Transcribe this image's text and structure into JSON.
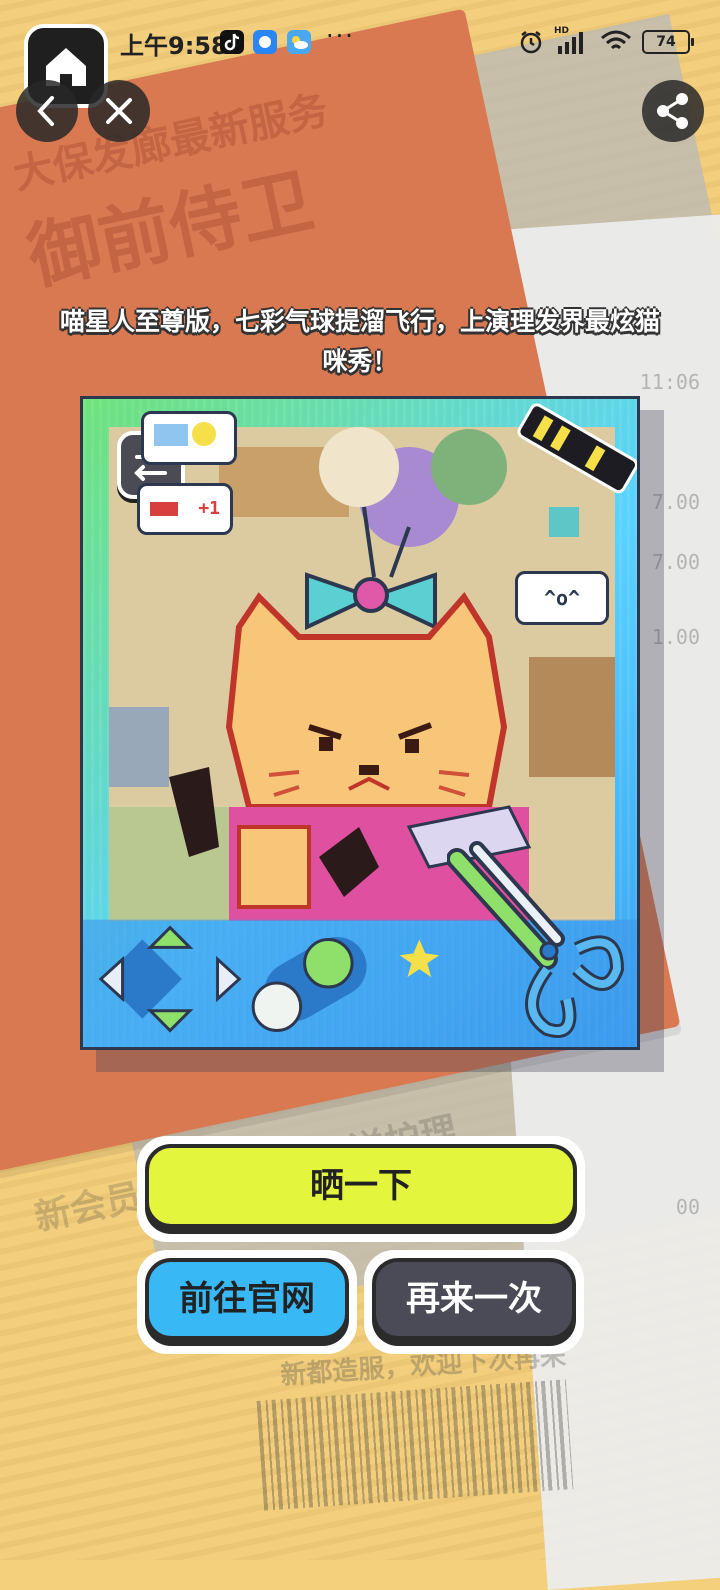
{
  "status_bar": {
    "time": "上午9:58",
    "dots": "···",
    "network": "HD",
    "wifi_label": "6",
    "battery": "74",
    "apps": [
      "tiktok-icon",
      "chat-app-icon",
      "weather-icon"
    ]
  },
  "nav": {
    "home_icon": "home-icon",
    "back_icon": "chevron-left-icon",
    "close_icon": "close-icon",
    "share_icon": "share-icon"
  },
  "background": {
    "poster_line_1": "大保发廊最新服务",
    "poster_line_2": "御前侍卫",
    "poster_bottom": "新会员  满500，染发送护理",
    "receipt_lines": [
      "11:06",
      "7.00",
      "7.00",
      "1.00",
      "1.00",
      "00"
    ],
    "receipt_footer": "新都造服，欢迎下次再来"
  },
  "description": "喵星人至尊版，七彩气球提溜飞行，上演理发界最炫猫咪秀！",
  "card": {
    "face_bubble": "^o^",
    "plus_bubble": "+1",
    "swap_icon": "swap-icon"
  },
  "buttons": {
    "share": "晒一下",
    "website": "前往官网",
    "again": "再来一次"
  },
  "colors": {
    "share_btn": "#e3f53c",
    "website_btn": "#38b8f5",
    "again_btn": "#4b4b57",
    "poster": "#d97952",
    "background": "#f3cd79"
  }
}
